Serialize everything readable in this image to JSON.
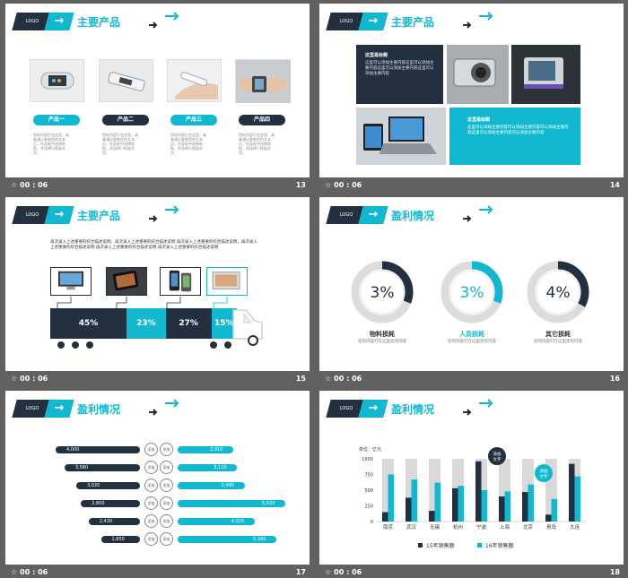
{
  "footer": {
    "star": "☆",
    "duration": "00 : 06"
  },
  "colors": {
    "cyan": "#12b8cf",
    "navy": "#22303f",
    "gray": "#d9d9d9",
    "bg": "#616161"
  },
  "logo": "LOGO",
  "slide13": {
    "title": "主要产品",
    "number": "13",
    "products": [
      {
        "label": "产品一",
        "style": "cyan",
        "desc": "您的内容打在这里，或者通过复制您的文本后，在此框中选择粘贴，并选择只保留文字。"
      },
      {
        "label": "产品二",
        "style": "navy",
        "desc": "您的内容打在这里，或者通过复制您的文本后，在此框中选择粘贴，并选择只保留文字。"
      },
      {
        "label": "产品三",
        "style": "cyan",
        "desc": "您的内容打在这里，或者通过复制您的文本后，在此框中选择粘贴，并选择只保留文字。"
      },
      {
        "label": "产品四",
        "style": "navy",
        "desc": "您的内容打在这里，或者通过复制您的文本后，在此框中选择粘贴，并选择只保留文字。"
      }
    ]
  },
  "slide14": {
    "title": "主要产品",
    "number": "14",
    "box1": {
      "heading": "这里是标题",
      "body": "这里可以添加主要内容这里可以添加主要内容这里可以添加主要内容这里可以添加主要内容"
    },
    "box2": {
      "heading": "这里是标题",
      "body": "这里可以添加主要内容可以添加主要内容可以添加主要内容这里可以添加主要内容可以添加主要内容"
    }
  },
  "slide15": {
    "title": "主要产品",
    "number": "15",
    "intro": "再次录入上述重要的综合描述说明，再次录入上述重要的综合描述说明 再次录入上述重要的综合描述说明，再次录入上述重要的综合描述说明 再次录入上述重要的综合描述说明 再次录入上述重要的综合描述说明",
    "segments": [
      {
        "value": "45%",
        "fraction": 0.45,
        "color": "navy"
      },
      {
        "value": "23%",
        "fraction": 0.23,
        "color": "cyan"
      },
      {
        "value": "27%",
        "fraction": 0.27,
        "color": "navy"
      },
      {
        "value": "15%",
        "fraction": 0.15,
        "color": "cyan"
      }
    ]
  },
  "slide16": {
    "title": "盈利情况",
    "number": "16",
    "rings": [
      {
        "value": "3%",
        "fraction": 0.03,
        "label": "物料损耗",
        "desc": "您的内容打在这里您的内容",
        "color": "navy"
      },
      {
        "value": "3%",
        "fraction": 0.03,
        "label": "人员损耗",
        "desc": "您的内容打在这里您的内容",
        "color": "cyan"
      },
      {
        "value": "4%",
        "fraction": 0.04,
        "label": "其它损耗",
        "desc": "您的内容打在这里您的内容",
        "color": "navy"
      }
    ]
  },
  "slide17": {
    "title": "盈利情况",
    "number": "17",
    "circle_text": "添加",
    "left": [
      "4,000",
      "3,580",
      "3,020",
      "2,800",
      "2,430",
      "1,850"
    ],
    "right": [
      "2,910",
      "3,110",
      "3,490",
      "5,620",
      "4,020",
      "5,160"
    ],
    "left_values": [
      4000,
      3580,
      3020,
      2800,
      2430,
      1850
    ],
    "right_values": [
      2910,
      3110,
      3490,
      5620,
      4020,
      5160
    ]
  },
  "slide18": {
    "title": "盈利情况",
    "number": "18",
    "unit": "单位：亿元",
    "callout1": "添加文字",
    "callout2": "添加文字",
    "chart_data": {
      "type": "bar",
      "categories": [
        "南京",
        "武汉",
        "无锡",
        "杭州",
        "宁波",
        "上海",
        "北京",
        "青岛",
        "大连"
      ],
      "series": [
        {
          "name": "15年销售额",
          "color": "#22303f",
          "values": [
            150,
            380,
            170,
            530,
            960,
            400,
            470,
            110,
            920
          ]
        },
        {
          "name": "16年销售额",
          "color": "#12b8cf",
          "values": [
            750,
            670,
            620,
            570,
            500,
            480,
            590,
            360,
            720
          ]
        }
      ],
      "yticks": [
        "0",
        "250",
        "500",
        "750",
        "1000"
      ],
      "ylim": [
        0,
        1000
      ]
    }
  }
}
